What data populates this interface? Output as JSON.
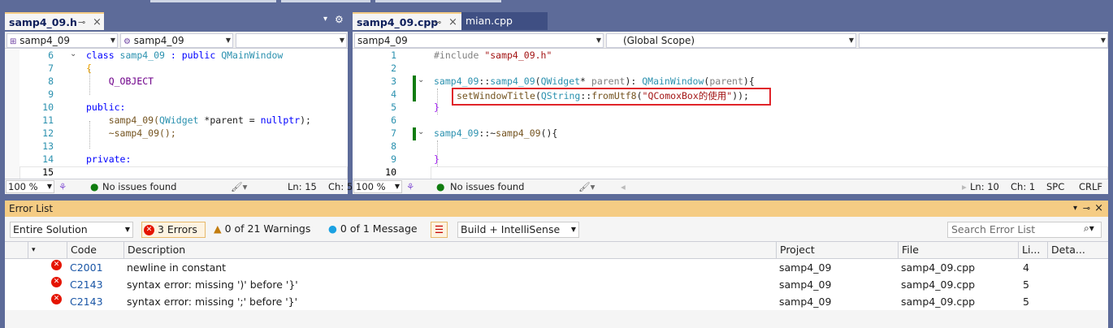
{
  "tabs": {
    "left_active": "samp4_09.h",
    "right_active": "samp4_09.cpp",
    "right_inactive": "mian.cpp",
    "pin_glyph": "⊸",
    "close_glyph": "×",
    "dropdown_glyph": "▾",
    "settings_glyph": "⚙"
  },
  "left_editor": {
    "nav_class": "samp4_09",
    "nav_member": "samp4_09",
    "nav_third": "",
    "line_numbers": [
      "6",
      "7",
      "8",
      "9",
      "10",
      "11",
      "12",
      "13",
      "14",
      "15"
    ],
    "lines": [
      [
        "class ",
        "samp4_09",
        " : public ",
        "QMainWindow"
      ],
      [
        "{"
      ],
      [
        "    ",
        "Q_OBJECT"
      ],
      [
        ""
      ],
      [
        "public:"
      ],
      [
        "    samp4_09(",
        "QWidget",
        " *parent = ",
        "nullptr",
        ");"
      ],
      [
        "    ~samp4_09();"
      ],
      [
        ""
      ],
      [
        "private:"
      ],
      [
        ""
      ]
    ],
    "zoom": "100 %",
    "issues": "No issues found",
    "ln": "Ln: 15",
    "ch": "Ch: 5"
  },
  "right_editor": {
    "nav_project": "samp4_09",
    "nav_scope": "(Global Scope)",
    "nav_third": "",
    "line_numbers": [
      "1",
      "2",
      "3",
      "4",
      "5",
      "6",
      "7",
      "8",
      "9",
      "10"
    ],
    "line1_pp": "#include ",
    "line1_str": "\"samp4_09.h\"",
    "line3": {
      "a": "samp4_09",
      "b": "::",
      "c": "samp4_09",
      "d": "(",
      "e": "QWidget",
      "f": "* ",
      "g": "parent",
      "h": "): ",
      "i": "QMainWindow",
      "j": "(",
      "k": "parent",
      "l": "){"
    },
    "line4": {
      "a": "setWindowTitle",
      "b": "(",
      "c": "QString",
      "d": "::",
      "e": "fromUtf8",
      "f": "(",
      "g": "\"QComoxBox的使用\"",
      "h": "));"
    },
    "line5": "}",
    "line7": {
      "a": "samp4_09",
      "b": "::~",
      "c": "samp4_09",
      "d": "(){"
    },
    "line9": "}",
    "zoom": "100 %",
    "issues": "No issues found",
    "ln": "Ln: 10",
    "ch": "Ch: 1",
    "spc": "SPC",
    "crlf": "CRLF"
  },
  "error_list": {
    "title": "Error List",
    "scope": "Entire Solution",
    "errors_btn": "3 Errors",
    "warnings_btn": "0 of 21 Warnings",
    "messages_btn": "0 of 1 Message",
    "build_filter": "Build + IntelliSense",
    "search_placeholder": "Search Error List",
    "columns": {
      "code": "Code",
      "description": "Description",
      "project": "Project",
      "file": "File",
      "line": "Li...",
      "details": "Deta..."
    },
    "rows": [
      {
        "code": "C2001",
        "description": "newline in constant",
        "project": "samp4_09",
        "file": "samp4_09.cpp",
        "line": "4"
      },
      {
        "code": "C2143",
        "description": "syntax error: missing ')' before '}'",
        "project": "samp4_09",
        "file": "samp4_09.cpp",
        "line": "5"
      },
      {
        "code": "C2143",
        "description": "syntax error: missing ';' before '}'",
        "project": "samp4_09",
        "file": "samp4_09.cpp",
        "line": "5"
      }
    ]
  },
  "colors": {
    "accent": "#f5cc84",
    "error": "#e51400",
    "link": "#1a56a6",
    "chrome": "#5d6b99"
  }
}
